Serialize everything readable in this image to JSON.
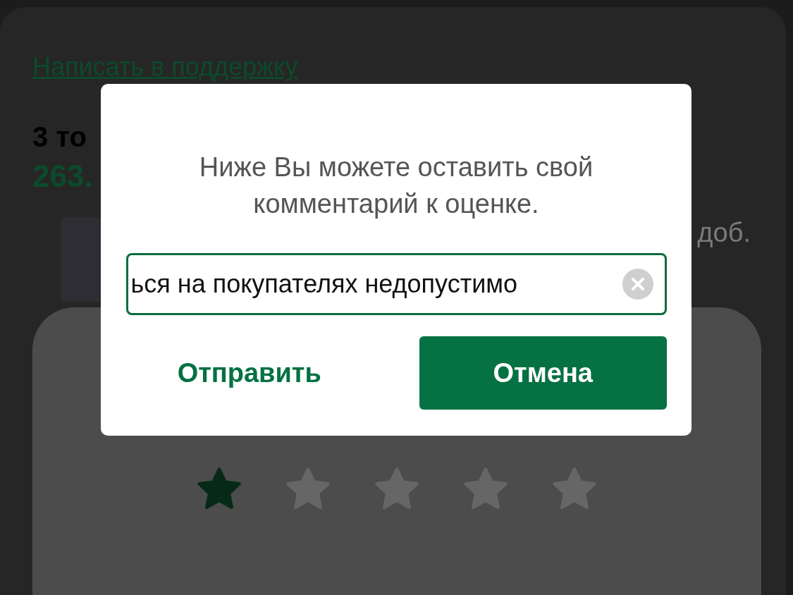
{
  "page": {
    "support_link": "Написать в поддержку",
    "order_title": "3 то",
    "order_price": "263.",
    "product_note": "доб."
  },
  "rating": {
    "stars": 1
  },
  "dialog": {
    "message": "Ниже Вы можете оставить свой комментарий к оценке.",
    "comment": {
      "value": "ься на покупателях недопустимо"
    },
    "buttons": [
      {
        "label": "Отправить",
        "kind": "text"
      },
      {
        "label": "Отмена",
        "kind": "filled"
      }
    ]
  }
}
